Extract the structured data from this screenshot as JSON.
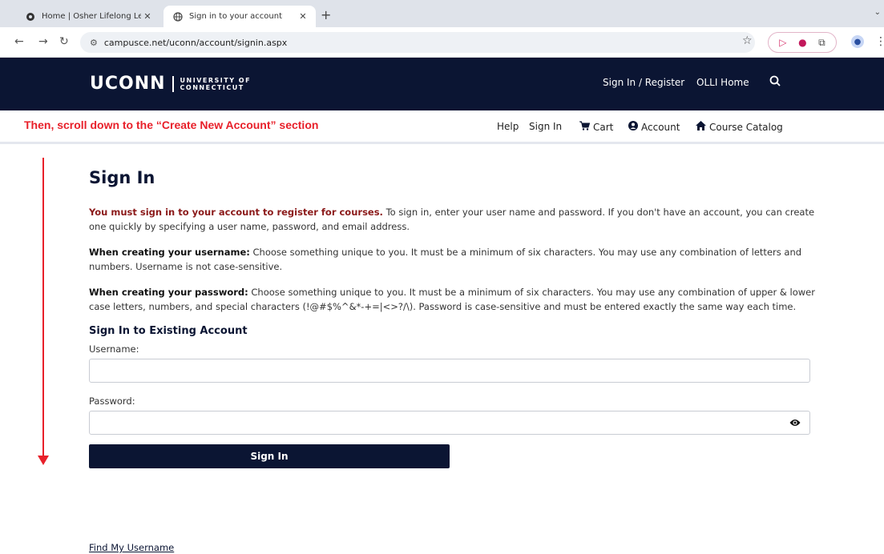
{
  "browser": {
    "tabs": [
      {
        "title": "Home | Osher Lifelong Learnin",
        "active": false
      },
      {
        "title": "Sign in to your account",
        "active": true
      }
    ],
    "new_tab": "+",
    "url": "campusce.net/uconn/account/signin.aspx"
  },
  "header": {
    "logo_word": "UCONN",
    "logo_line1": "UNIVERSITY OF",
    "logo_line2": "CONNECTICUT",
    "nav": [
      "Sign In / Register",
      "OLLI Home"
    ]
  },
  "subnav": {
    "annotation": "Then, scroll down to the “Create New Account” section",
    "links": [
      "Help",
      "Sign In",
      "Cart",
      "Account",
      "Course Catalog"
    ]
  },
  "main": {
    "title": "Sign In",
    "p1_bold": "You must sign in to your account to register for courses.",
    "p1_rest": " To sign in, enter your user name and password. If you don't have an account, you can create one quickly by specifying a user name, password, and email address.",
    "p2_bold": "When creating your username:",
    "p2_rest": " Choose something unique to you. It must be a minimum of six characters. You may use any combination of letters and numbers. Username is not case-sensitive.",
    "p3_bold": "When creating your password:",
    "p3_rest": " Choose something unique to you. It must be a minimum of six characters. You may use any combination of upper & lower case letters, numbers, and special characters (!@#$%^&*-+=|<>?/\\). Password is case-sensitive and must be entered exactly the same way each time.",
    "section_title": "Sign In to Existing Account",
    "username_label": "Username:",
    "password_label": "Password:",
    "username_value": "",
    "password_value": "",
    "submit_label": "Sign In",
    "find_username": "Find My Username"
  },
  "colors": {
    "navy": "#0b1533",
    "annotation_red": "#e8202a",
    "emphasis_red": "#8b1a1a"
  }
}
